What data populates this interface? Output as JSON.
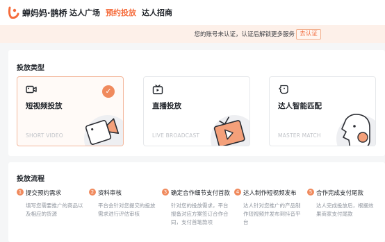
{
  "nav": {
    "brand": "蝉妈妈·鹊桥",
    "items": [
      {
        "label": "达人广场",
        "active": false
      },
      {
        "label": "预约投放",
        "active": true
      },
      {
        "label": "达人招商",
        "active": false
      }
    ]
  },
  "notice": {
    "text": "您的账号未认证，认证后解锁更多服务",
    "button": "去认证"
  },
  "delivery_type": {
    "title": "投放类型",
    "options": [
      {
        "title": "短视频投放",
        "subtitle": "SHORT VIDEO",
        "icon": "video-camera-icon",
        "selected": true
      },
      {
        "title": "直播投放",
        "subtitle": "LIVE BROADCAST",
        "icon": "tv-icon",
        "selected": false
      },
      {
        "title": "达人智能匹配",
        "subtitle": "MASTER MATCH",
        "icon": "person-icon",
        "selected": false
      }
    ],
    "check_glyph": "✓"
  },
  "flow": {
    "title": "投放流程",
    "steps": [
      {
        "num": "1",
        "title": "提交预约需求",
        "desc": "填写您需要推广的商品以及相应的货源"
      },
      {
        "num": "2",
        "title": "资料审核",
        "desc": "平台会针对您提交的投放需求进行评估审核"
      },
      {
        "num": "3",
        "title": "确定合作细节支付首款",
        "desc": "针对您的投放需求，平台报备对应方案签订合作合同，支付首笔款项"
      },
      {
        "num": "4",
        "title": "达人制作短视频发布",
        "desc": "达人针对您推广的产品制作短视频并发布到抖音平台"
      },
      {
        "num": "5",
        "title": "合作完成支付尾款",
        "desc": "达人完成投放后，根据效果商家支付尾款"
      }
    ]
  },
  "colors": {
    "accent": "#f08a5d",
    "nav_active": "#f56c3c",
    "notice_bg": "#fdf0e9",
    "selected_border": "#f3b79c"
  }
}
